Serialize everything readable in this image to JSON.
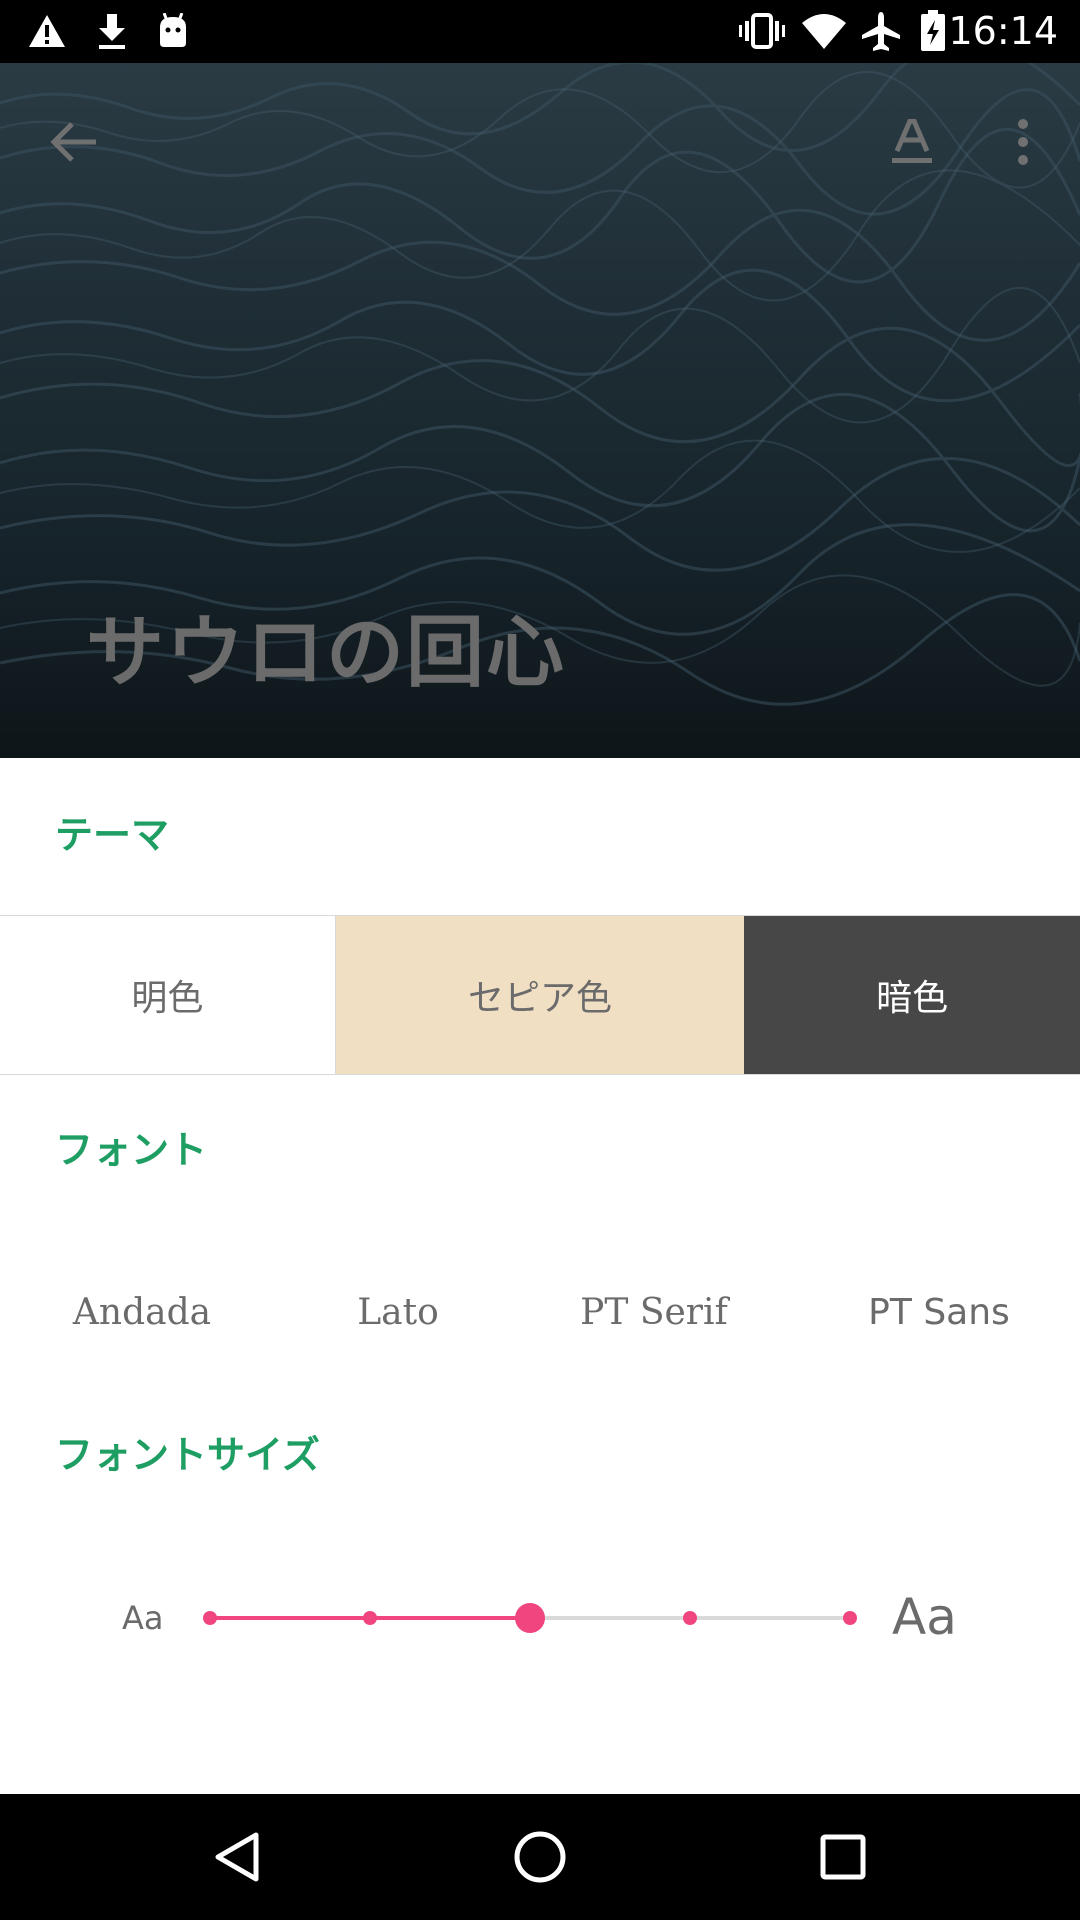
{
  "status_bar": {
    "time": "16:14",
    "left_icons": [
      "warning-icon",
      "download-icon",
      "android-icon"
    ],
    "right_icons": [
      "vibrate-icon",
      "wifi-icon",
      "airplane-icon",
      "battery-charging-icon"
    ]
  },
  "hero": {
    "title": "サウロの回心",
    "actions": [
      "back-arrow-icon",
      "text-format-icon",
      "more-vert-icon"
    ]
  },
  "settings": {
    "theme": {
      "label": "テーマ",
      "options": [
        "明色",
        "セピア色",
        "暗色"
      ],
      "selected": "セピア色"
    },
    "font": {
      "label": "フォント",
      "options": [
        "Andada",
        "Lato",
        "PT Serif",
        "PT Sans"
      ]
    },
    "font_size": {
      "label": "フォントサイズ",
      "small_label": "Aa",
      "large_label": "Aa",
      "steps": 5,
      "selected_step": 3
    }
  },
  "colors": {
    "accent_green": "#1e9e63",
    "slider_pink": "#f0457f",
    "sepia": "#f0dfc3",
    "dark_theme": "#474747"
  },
  "nav_bar": [
    "back-triangle-icon",
    "home-circle-icon",
    "recents-square-icon"
  ]
}
